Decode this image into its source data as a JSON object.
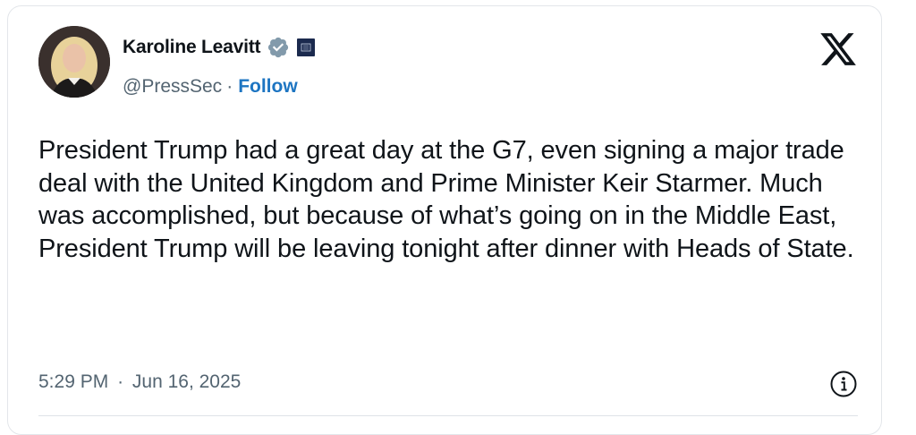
{
  "tweet": {
    "author": {
      "display_name": "Karoline Leavitt",
      "handle": "@PressSec",
      "separator": "·",
      "follow_label": "Follow"
    },
    "text": "President Trump had a great day at the G7, even signing a major trade deal with the United Kingdom and Prime Minister Keir Starmer. Much was accomplished, but because of what’s going on in the Middle East, President Trump will be leaving tonight after dinner with Heads of State.",
    "time": "5:29 PM",
    "date": "Jun 16, 2025",
    "meta_separator": "·"
  },
  "icons": {
    "verified": "verified-badge-icon",
    "affiliation": "government-affiliation-icon",
    "platform": "x-logo-icon",
    "info": "info-icon"
  },
  "colors": {
    "verified_badge": "#829aab",
    "follow_link": "#1d75c2",
    "text_primary": "#0f1419",
    "text_secondary": "#536471"
  }
}
